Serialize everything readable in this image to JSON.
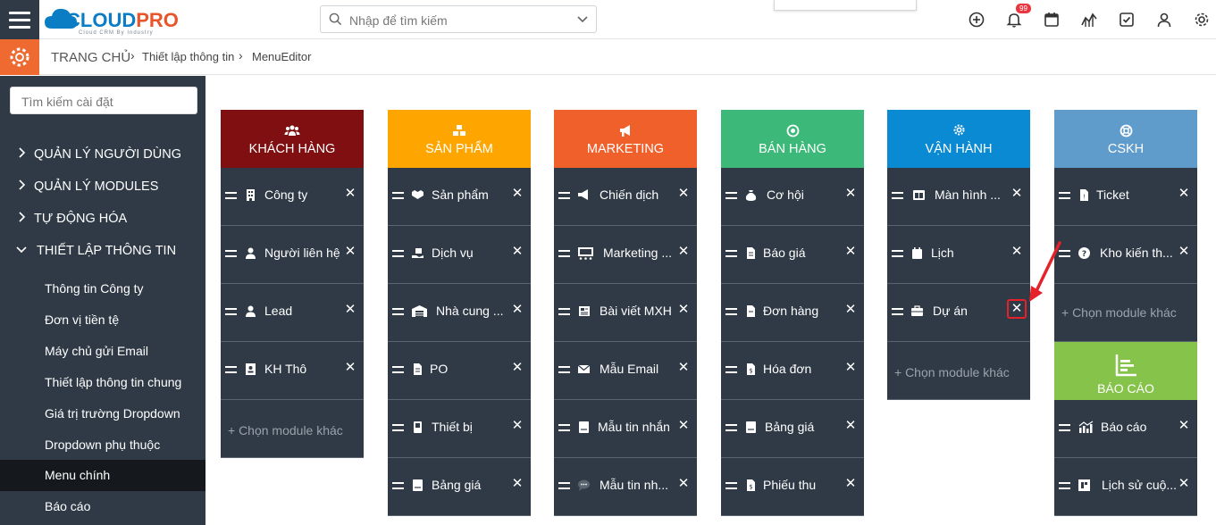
{
  "topbar": {
    "logo_text_1": "CLOUD",
    "logo_text_2": "PRO",
    "logo_tagline": "Cloud CRM By Industry",
    "search_placeholder": "Nhập để tìm kiếm",
    "notif_count": "99"
  },
  "breadcrumb": {
    "home": "TRANG CHỦ",
    "sep1": "›",
    "level1": "Thiết lập thông tin",
    "sep2": "›",
    "level2": "MenuEditor"
  },
  "sidebar": {
    "search_placeholder": "Tìm kiếm cài đặt",
    "groups": [
      {
        "label": "QUẢN LÝ NGƯỜI DÙNG"
      },
      {
        "label": "QUẢN LÝ MODULES"
      },
      {
        "label": "TỰ ĐỘNG HÓA"
      },
      {
        "label": "THIẾT LẬP THÔNG TIN"
      }
    ],
    "items": [
      {
        "label": "Thông tin Công ty"
      },
      {
        "label": "Đơn vị tiền tệ"
      },
      {
        "label": "Máy chủ gửi Email"
      },
      {
        "label": "Thiết lập thông tin chung"
      },
      {
        "label": "Giá trị trường Dropdown"
      },
      {
        "label": "Dropdown phụ thuộc"
      },
      {
        "label": "Menu chính"
      },
      {
        "label": "Báo cáo"
      }
    ]
  },
  "columns": [
    {
      "title": "KHÁCH HÀNG",
      "color": "#7f0f11",
      "rows": [
        {
          "label": "Công ty"
        },
        {
          "label": "Người liên hệ"
        },
        {
          "label": "Lead"
        },
        {
          "label": "KH Thô"
        }
      ],
      "add_label": "+ Chọn module khác"
    },
    {
      "title": "SẢN PHẨM",
      "color": "#ffa500",
      "rows": [
        {
          "label": "Sản phẩm"
        },
        {
          "label": "Dịch vụ"
        },
        {
          "label": "Nhà cung ..."
        },
        {
          "label": "PO"
        },
        {
          "label": "Thiết bị"
        },
        {
          "label": "Bảng giá"
        }
      ]
    },
    {
      "title": "MARKETING",
      "color": "#f0602b",
      "rows": [
        {
          "label": "Chiến dịch"
        },
        {
          "label": "Marketing ..."
        },
        {
          "label": "Bài viết MXH"
        },
        {
          "label": "Mẫu Email"
        },
        {
          "label": "Mẫu tin nhắn"
        },
        {
          "label": "Mẫu tin nh..."
        }
      ]
    },
    {
      "title": "BÁN HÀNG",
      "color": "#3cb878",
      "rows": [
        {
          "label": "Cơ hội"
        },
        {
          "label": "Báo giá"
        },
        {
          "label": "Đơn hàng"
        },
        {
          "label": "Hóa đơn"
        },
        {
          "label": "Bảng giá"
        },
        {
          "label": "Phiếu thu"
        }
      ]
    },
    {
      "title": "VẬN HÀNH",
      "color": "#0a8ad3",
      "rows": [
        {
          "label": "Màn hình ..."
        },
        {
          "label": "Lịch"
        },
        {
          "label": "Dự án"
        }
      ],
      "add_label": "+ Chọn module khác"
    },
    {
      "title": "CSKH",
      "color": "#5f9bcb",
      "rows": [
        {
          "label": "Ticket"
        },
        {
          "label": "Kho kiến th..."
        }
      ],
      "add_label": "+ Chọn module khác"
    },
    {
      "title": "BÁO CÁO",
      "color": "#86c34a",
      "rows": [
        {
          "label": "Báo cáo"
        },
        {
          "label": "Lịch sử cuộ..."
        }
      ]
    }
  ],
  "close_glyph": "✕"
}
